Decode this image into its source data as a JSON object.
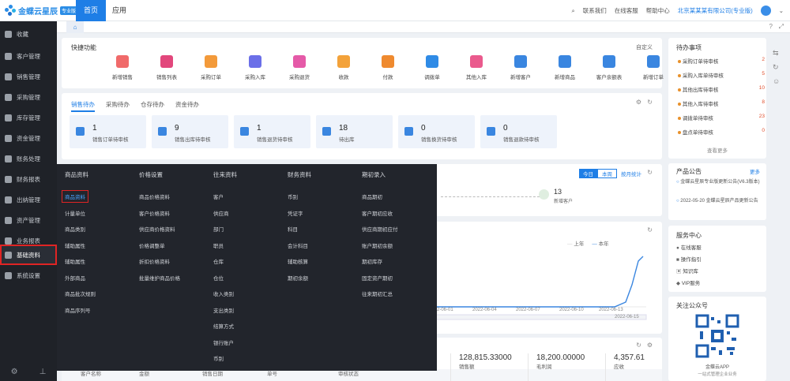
{
  "app": {
    "logo_text": "金蝶云星辰",
    "logo_badge": "专业版"
  },
  "top_tabs": [
    {
      "label": "首页",
      "active": true
    },
    {
      "label": "应用",
      "active": false
    }
  ],
  "top_right": {
    "contact": "联系我们",
    "online": "在线客服",
    "help": "帮助中心",
    "account": "北京某某某有限公司(专业版)"
  },
  "sidebar": {
    "items": [
      {
        "label": "收藏",
        "icon": "star-icon"
      },
      {
        "label": "客户管理",
        "icon": "user-icon"
      },
      {
        "label": "销售管理",
        "icon": "cart-icon"
      },
      {
        "label": "采购管理",
        "icon": "box-icon"
      },
      {
        "label": "库存管理",
        "icon": "warehouse-icon"
      },
      {
        "label": "资金管理",
        "icon": "money-icon"
      },
      {
        "label": "账务处理",
        "icon": "ledger-icon"
      },
      {
        "label": "财务报表",
        "icon": "report-icon"
      },
      {
        "label": "出纳管理",
        "icon": "cashier-icon"
      },
      {
        "label": "资产管理",
        "icon": "asset-icon"
      },
      {
        "label": "业务报表",
        "icon": "chart-icon"
      },
      {
        "label": "基础资料",
        "icon": "data-icon",
        "highlighted": true
      },
      {
        "label": "系统设置",
        "icon": "gear-icon"
      }
    ]
  },
  "quick": {
    "title": "快捷功能",
    "edit": "自定义",
    "items": [
      {
        "label": "新增销售",
        "color": "#f06a6a"
      },
      {
        "label": "销售列表",
        "color": "#e2477c"
      },
      {
        "label": "采购订单",
        "color": "#f39a3a"
      },
      {
        "label": "采购入库",
        "color": "#6b6fe8"
      },
      {
        "label": "采购退货",
        "color": "#e55aa8"
      },
      {
        "label": "收款",
        "color": "#f3a23a"
      },
      {
        "label": "付款",
        "color": "#ef8a2f"
      },
      {
        "label": "调拨单",
        "color": "#2f8be6"
      },
      {
        "label": "其他入库",
        "color": "#ea5a8d"
      },
      {
        "label": "新增客户",
        "color": "#3a86e0"
      },
      {
        "label": "新增商品",
        "color": "#3a86e0"
      },
      {
        "label": "客户余额表",
        "color": "#3a86e0"
      },
      {
        "label": "新增订单",
        "color": "#3a86e0"
      }
    ]
  },
  "todo": {
    "tabs": [
      "销售待办",
      "采购待办",
      "仓存待办",
      "资金待办"
    ],
    "boxes": [
      {
        "num": "1",
        "label": "销售订单待审核"
      },
      {
        "num": "9",
        "label": "销售出库待审核"
      },
      {
        "num": "1",
        "label": "销售退货待审核"
      },
      {
        "num": "18",
        "label": "待出库"
      },
      {
        "num": "0",
        "label": "销售换货待审核"
      },
      {
        "num": "0",
        "label": "销售退款待审核"
      }
    ]
  },
  "notice": {
    "title": "待办事项",
    "items": [
      {
        "label": "采购订单待审核",
        "count": "2"
      },
      {
        "label": "采购入库单待审核",
        "count": "5"
      },
      {
        "label": "其他出库待审核",
        "count": "10"
      },
      {
        "label": "其他入库待审核",
        "count": "8"
      },
      {
        "label": "调拨单待审核",
        "count": "23"
      },
      {
        "label": "盘点单待审核",
        "count": "0"
      }
    ],
    "more": "查看更多"
  },
  "announce": {
    "title": "产品公告",
    "more": "更多",
    "items": [
      {
        "text": "金蝶云星辰专业版更新公告(V6.3版本)"
      },
      {
        "text": "2022-05-20 金蝶云星辰产品更新公告"
      }
    ]
  },
  "services": {
    "title": "服务中心",
    "items": [
      "在线客服",
      "操作指引",
      "知识库",
      "VIP服务"
    ]
  },
  "qr": {
    "title": "关注公众号",
    "caption": "金蝶云APP",
    "sub": "一站式管理企业业务"
  },
  "sales_panel": {
    "filter_today": "今日",
    "filter_week": "本周",
    "filter_custom": "按月统计",
    "stat_num": "13",
    "stat_label": "新增客户"
  },
  "chart": {
    "legend": [
      "上年",
      "本年"
    ],
    "x_labels": [
      "2022-06-01",
      "2022-06-04",
      "2022-06-07",
      "2022-06-10",
      "2022-06-13",
      "2022-06-15"
    ]
  },
  "bottom_stats": [
    {
      "value": "128,815.33000",
      "label": "销售额"
    },
    {
      "value": "18,200.00000",
      "label": "毛利润"
    },
    {
      "value": "4,357.61",
      "label": "应收"
    }
  ],
  "table_headers": [
    "客户名称",
    "金额",
    "销售日期",
    "单号",
    "审核状态"
  ],
  "mega": {
    "columns": [
      {
        "head": "商品资料",
        "items": [
          "商品资料",
          "计量单位",
          "商品类别",
          "辅助属性",
          "辅助属性",
          "外部商品",
          "商品批次规则",
          "商品序列号"
        ]
      },
      {
        "head": "价格设置",
        "items": [
          "商品价格资料",
          "客户价格资料",
          "供应商价格资料",
          "价格调整单",
          "折扣价格资料",
          "批量维护商品价格"
        ]
      },
      {
        "head": "往来资料",
        "items": [
          "客户",
          "供应商",
          "部门",
          "职员",
          "仓库",
          "仓位",
          "收入类别",
          "支出类别",
          "结算方式",
          "银行账户",
          "币别"
        ]
      },
      {
        "head": "财务资料",
        "items": [
          "币别",
          "凭证字",
          "科目",
          "会计科目",
          "辅助核算",
          "期初余额"
        ]
      },
      {
        "head": "期初录入",
        "items": [
          "商品期初",
          "客户期初应收",
          "供应商期初应付",
          "账户期初余额",
          "期初库存",
          "固定资产期初",
          "往来期初汇总"
        ]
      }
    ]
  }
}
